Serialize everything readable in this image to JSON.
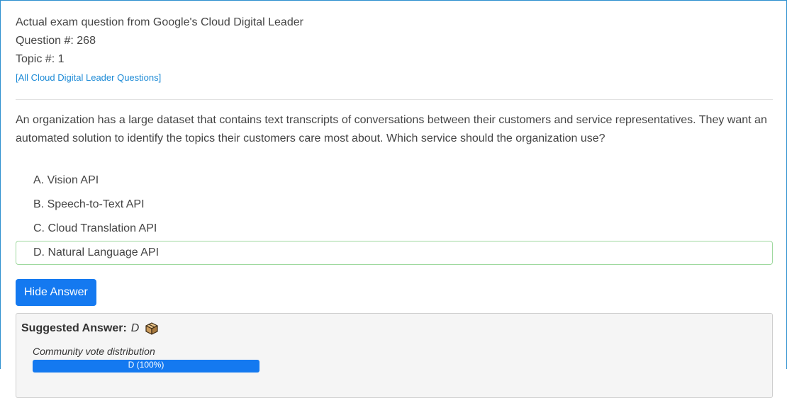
{
  "header": {
    "exam_line": "Actual exam question from Google's Cloud Digital Leader",
    "question_number": "Question #: 268",
    "topic_number": "Topic #: 1",
    "all_questions_link": "[All Cloud Digital Leader Questions]"
  },
  "question": {
    "text": "An organization has a large dataset that contains text transcripts of conversations between their customers and service representatives. They want an automated solution to identify the topics their customers care most about. Which service should the organization use?"
  },
  "choices": [
    {
      "label": "A. Vision API"
    },
    {
      "label": "B. Speech-to-Text API"
    },
    {
      "label": "C. Cloud Translation API"
    },
    {
      "label": "D. Natural Language API"
    }
  ],
  "answer_button": {
    "label": "Hide Answer"
  },
  "answer": {
    "suggested_label": "Suggested Answer:",
    "suggested_value": "D",
    "icon": "box-icon",
    "vote_title": "Community vote distribution",
    "vote_bar_text": "D (100%)",
    "vote_fraction": 1.0
  },
  "colors": {
    "accent": "#1479f0",
    "link": "#1c8ad6",
    "correct_border": "#9fd99f",
    "frame_border": "#2d8fcf"
  }
}
